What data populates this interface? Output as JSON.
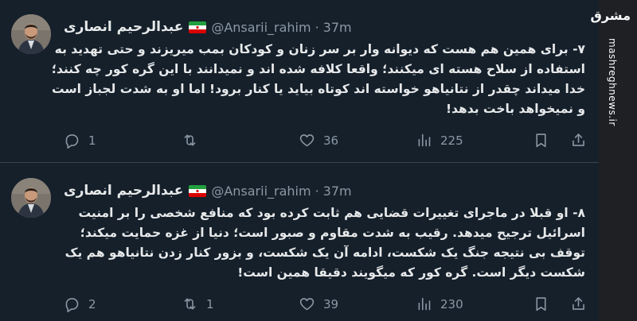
{
  "tweets": [
    {
      "author_name": "عبدالرحیم انصاری",
      "handle": "@Ansarii_rahim",
      "separator": "·",
      "time": "37m",
      "lines": [
        "۷- برای همین هم هست که دیوانه وار بر سر زنان و کودکان بمب میریزند و حتی تهدید به",
        "استفاده از سلاح هسته ای میکنند؛ واقعا کلافه شده اند و نمیدانند با این گره کور چه کنند؛",
        "خدا میداند چقدر از نتانیاهو خواسته اند کوتاه بیاید یا کنار برود! اما او به شدت لجباز است",
        "و نمیخواهد باخت بدهد!"
      ],
      "replies": "1",
      "retweets": "",
      "likes": "36",
      "views": "225"
    },
    {
      "author_name": "عبدالرحیم انصاری",
      "handle": "@Ansarii_rahim",
      "separator": "·",
      "time": "37m",
      "lines": [
        "۸- او قبلا در ماجرای تغییرات قضایی هم ثابت کرده بود که منافع شخصی را بر امنیت",
        "اسرائیل ترجیح میدهد. رقیب به شدت مقاوم و صبور است؛ دنیا از غزه حمایت میکند؛",
        "توقف بی نتیجه جنگ یک شکست، ادامه آن یک شکست، و بزور کنار زدن نتانیاهو هم یک",
        "شکست دیگر است. گره کور که میگویند دقیقا همین است!"
      ],
      "replies": "2",
      "retweets": "1",
      "likes": "39",
      "views": "230"
    }
  ],
  "icons": {
    "reply": "speech-bubble",
    "retweet": "retweet-arrows",
    "like": "heart",
    "views": "bar-chart",
    "bookmark": "bookmark",
    "share": "share-upload"
  },
  "watermark": {
    "logo_text": "مشرق",
    "url": "mashreghnews.ir"
  },
  "colors": {
    "background": "#15202b",
    "text": "#e7e9ea",
    "muted": "#8b98a5",
    "divider": "#38444d"
  }
}
